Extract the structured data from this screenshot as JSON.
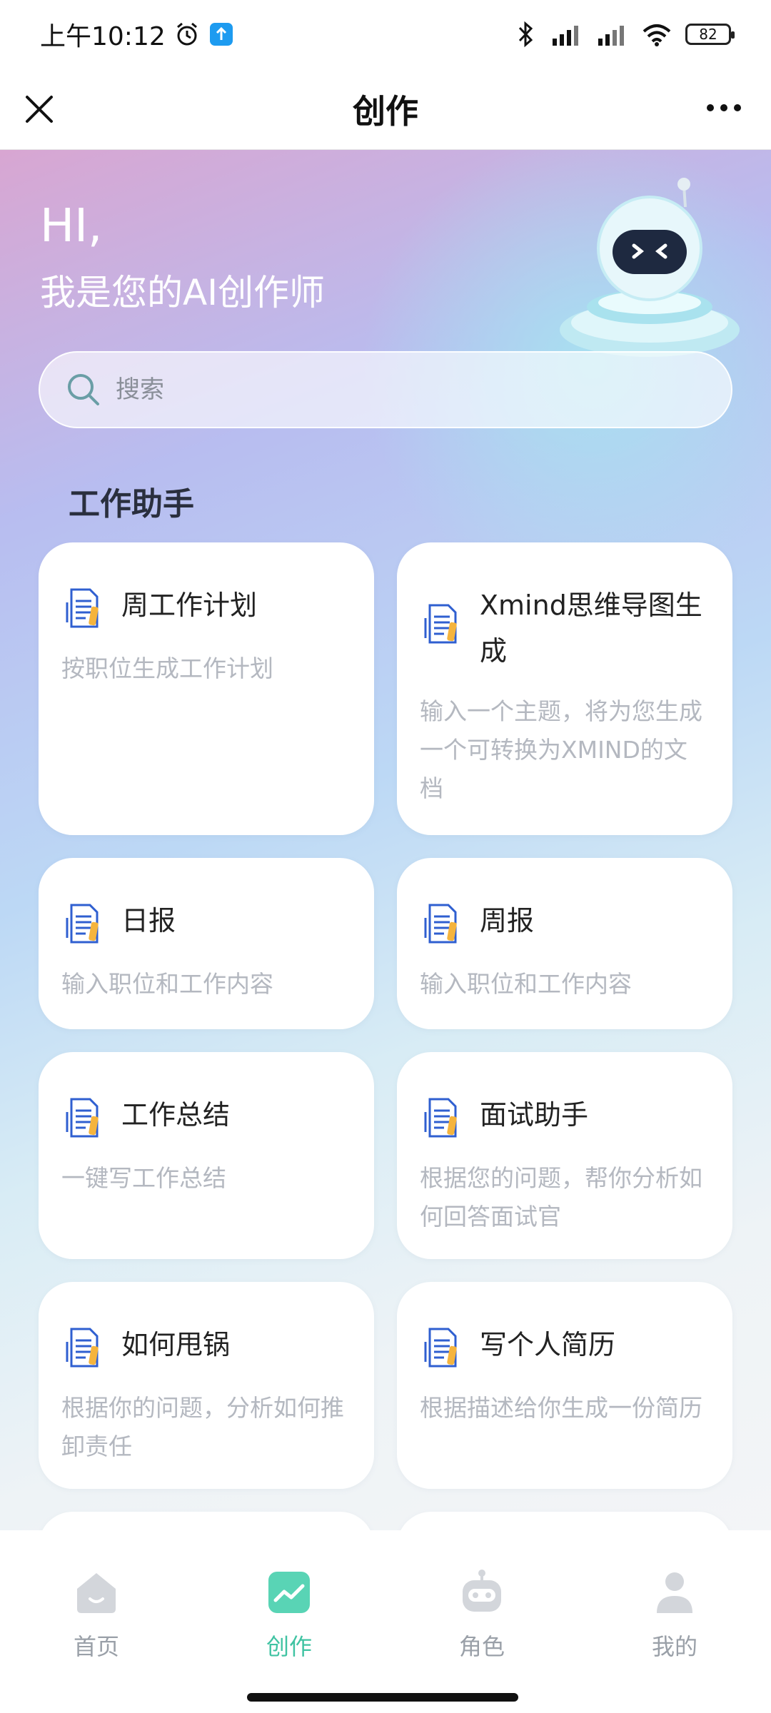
{
  "status_bar": {
    "time": "上午10:12",
    "battery": "82"
  },
  "header": {
    "title": "创作"
  },
  "hero": {
    "greeting": "HI,",
    "subtitle": "我是您的AI创作师"
  },
  "search": {
    "placeholder": "搜索"
  },
  "section": {
    "title": "工作助手"
  },
  "cards": [
    {
      "title": "周工作计划",
      "desc": "按职位生成工作计划"
    },
    {
      "title": "Xmind思维导图生成",
      "desc": "输入一个主题，将为您生成一个可转换为XMIND的文档"
    },
    {
      "title": "日报",
      "desc": "输入职位和工作内容"
    },
    {
      "title": "周报",
      "desc": "输入职位和工作内容"
    },
    {
      "title": "工作总结",
      "desc": "一键写工作总结"
    },
    {
      "title": "面试助手",
      "desc": "根据您的问题，帮你分析如何回答面试官"
    },
    {
      "title": "如何甩锅",
      "desc": "根据你的问题，分析如何推卸责任"
    },
    {
      "title": "写个人简历",
      "desc": "根据描述给你生成一份简历"
    }
  ],
  "tabbar": {
    "items": [
      {
        "label": "首页",
        "icon": "home-icon"
      },
      {
        "label": "创作",
        "icon": "create-icon"
      },
      {
        "label": "角色",
        "icon": "robot-icon"
      },
      {
        "label": "我的",
        "icon": "profile-icon"
      }
    ],
    "active": "创作",
    "active_color": "#3fc3a2"
  }
}
